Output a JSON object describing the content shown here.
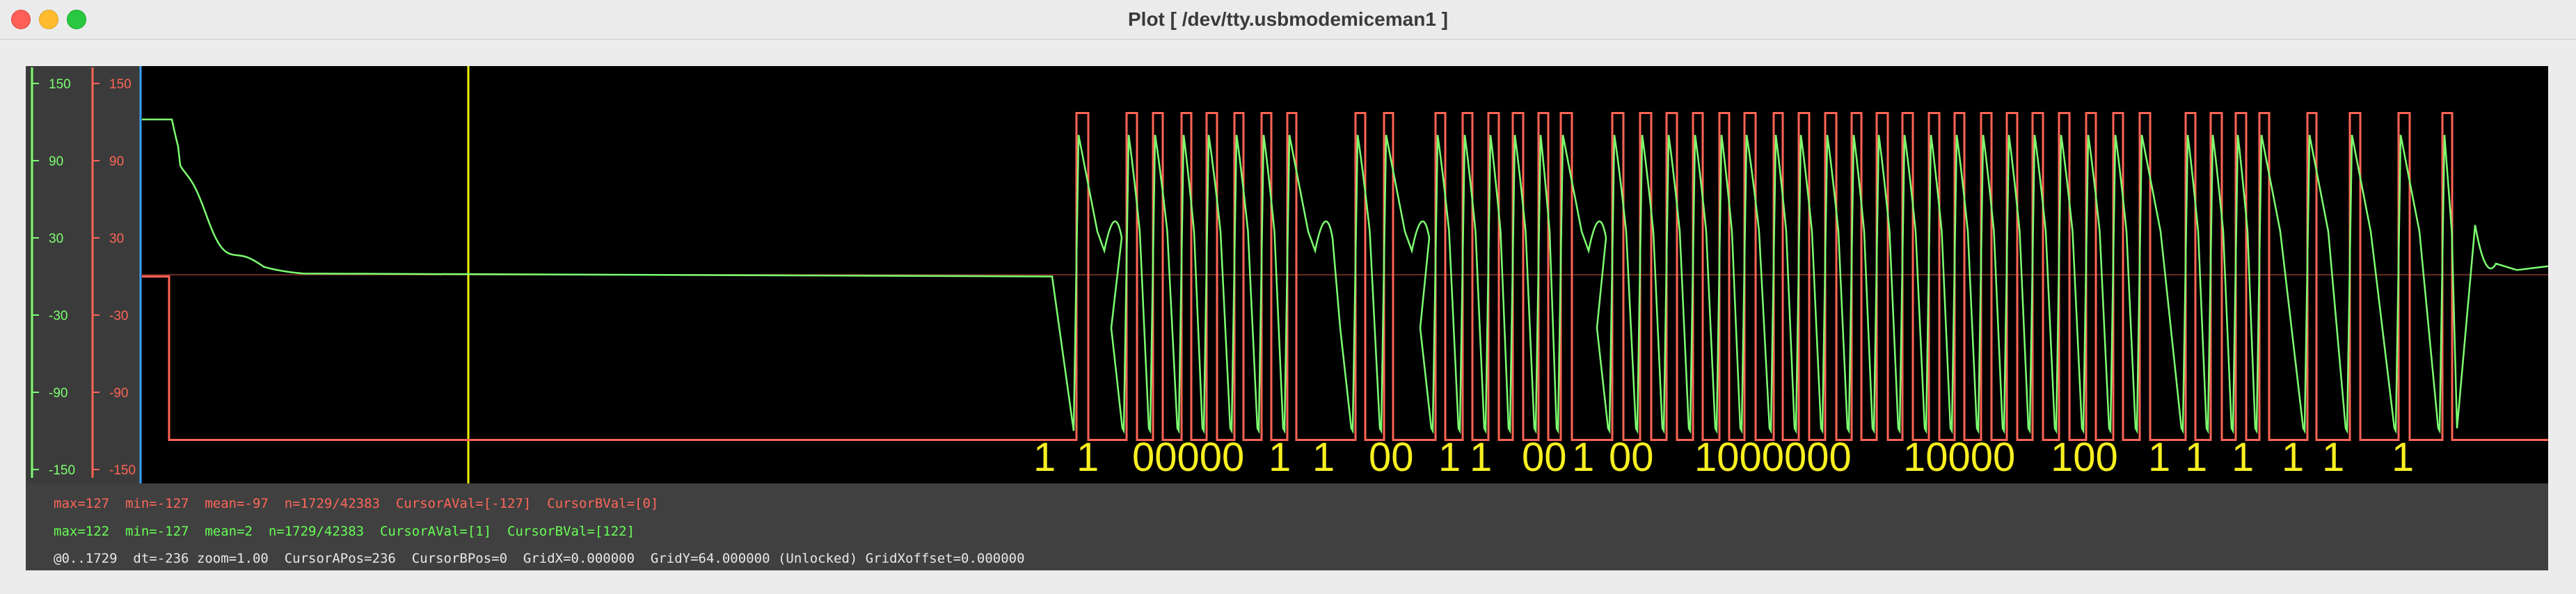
{
  "window": {
    "title": "Plot [ /dev/tty.usbmodemiceman1 ]"
  },
  "colors": {
    "green": "#7dff70",
    "red": "#ff6455",
    "cursorA": "#f0f000",
    "cursorB": "#3aa0ff",
    "bits": "#f8f020"
  },
  "axes": {
    "green_ticks": [
      "150",
      "90",
      "30",
      "-30",
      "-90",
      "-150"
    ],
    "red_ticks": [
      "150",
      "90",
      "30",
      "-30",
      "-90",
      "-150"
    ]
  },
  "bits": {
    "groups": [
      "1",
      "1",
      "00000",
      "1",
      "1",
      "00",
      "1",
      "1",
      "00",
      "1",
      "00",
      "1000000",
      "10000",
      "100",
      "1",
      "1",
      "1",
      "1",
      "1",
      "1"
    ]
  },
  "status": {
    "red_line": "max=127  min=-127  mean=-97  n=1729/42383  CursorAVal=[-127]  CursorBVal=[0]",
    "green_line": "max=122  min=-127  mean=2  n=1729/42383  CursorAVal=[1]  CursorBVal=[122]",
    "info_line": "@0..1729  dt=-236 zoom=1.00  CursorAPos=236  CursorBPos=0  GridX=0.000000  GridY=64.000000 (Unlocked) GridXoffset=0.000000"
  },
  "chart_data": {
    "type": "line",
    "y_range": [
      -150,
      150
    ],
    "ticks": [
      150,
      90,
      30,
      -30,
      -90,
      -150
    ],
    "cursors": {
      "A_pos": 236,
      "B_pos": 0
    },
    "series": [
      {
        "name": "red",
        "baseline_value": -127,
        "high_value": 127
      },
      {
        "name": "green",
        "settle_value": 0,
        "initial_value": 122
      }
    ]
  }
}
